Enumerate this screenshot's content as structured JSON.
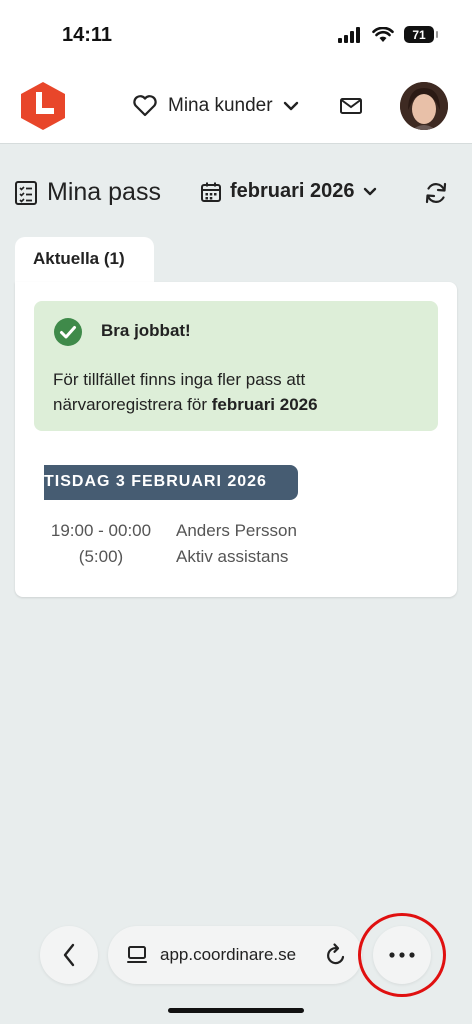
{
  "status_bar": {
    "time": "14:11",
    "battery": "71"
  },
  "header": {
    "customers_label": "Mina kunder"
  },
  "page": {
    "title": "Mina pass",
    "month": "februari 2026"
  },
  "tabs": [
    {
      "label": "Aktuella (1)"
    }
  ],
  "alert": {
    "title": "Bra jobbat!",
    "text_prefix": "För tillfället finns inga fler pass att närvaroregistrera för ",
    "text_bold": "februari 2026"
  },
  "shift": {
    "date_label": "TISDAG 3 FEBRUARI 2026",
    "time_range": "19:00 - 00:00",
    "duration": "(5:00)",
    "person": "Anders Persson",
    "service": "Aktiv assistans"
  },
  "browser": {
    "url": "app.coordinare.se"
  },
  "colors": {
    "brand": "#e8462a",
    "date_badge": "#465c72",
    "alert_bg": "#ddeed8",
    "check": "#3f8a4a",
    "highlight": "#e01010"
  }
}
